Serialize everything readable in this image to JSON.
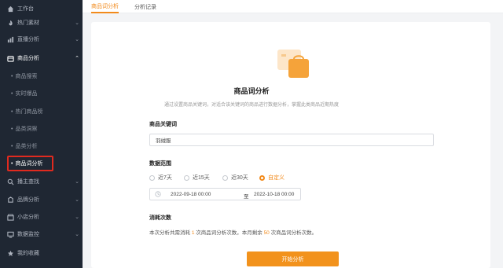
{
  "sidebar": {
    "items": [
      {
        "label": "工作台",
        "icon": "home-icon",
        "chevron": ""
      },
      {
        "label": "热门素材",
        "icon": "fire-icon",
        "chevron": "⌄"
      },
      {
        "label": "直播分析",
        "icon": "bar-chart-icon",
        "chevron": "⌄"
      },
      {
        "label": "商品分析",
        "icon": "box-icon",
        "chevron": "⌃"
      }
    ],
    "sub_items": [
      {
        "label": "商品搜索"
      },
      {
        "label": "实时爆品"
      },
      {
        "label": "热门商品榜"
      },
      {
        "label": "品类洞察"
      },
      {
        "label": "品类分析"
      },
      {
        "label": "商品词分析"
      }
    ],
    "bottom_items": [
      {
        "label": "播主查找",
        "icon": "search-icon",
        "chevron": "⌄"
      },
      {
        "label": "品牌分析",
        "icon": "brand-icon",
        "chevron": "⌄"
      },
      {
        "label": "小店分析",
        "icon": "shop-icon",
        "chevron": "⌄"
      },
      {
        "label": "数据监控",
        "icon": "monitor-icon",
        "chevron": "⌄"
      },
      {
        "label": "我的收藏",
        "icon": "star-icon",
        "chevron": ""
      }
    ],
    "dot": "•"
  },
  "tabs": [
    {
      "label": "商品词分析"
    },
    {
      "label": "分析记录"
    }
  ],
  "main": {
    "title": "商品词分析",
    "description": "通过设置商品关键词，对适合该关键词的商品进行数据分析，掌握此类商品近期热度",
    "keyword_label": "商品关键词",
    "keyword_value": "羽绒服",
    "range_label": "数据范围",
    "range_options": [
      {
        "label": "近7天"
      },
      {
        "label": "近15天"
      },
      {
        "label": "近30天"
      },
      {
        "label": "自定义"
      }
    ],
    "date_start": "2022-09-18 00:00",
    "date_sep": "至",
    "date_end": "2022-10-18 00:00",
    "usage_label": "消耗次数",
    "usage_text_1": "本次分析共需消耗 ",
    "usage_num_1": "1",
    "usage_text_2": " 次商品词分析次数，本月剩余 ",
    "usage_num_2": "50",
    "usage_text_3": " 次商品词分析次数。",
    "start_button": "开始分析"
  },
  "colors": {
    "accent": "#f2921c",
    "sidebar_bg": "#1f2733",
    "highlight_box": "#e02a1f"
  }
}
